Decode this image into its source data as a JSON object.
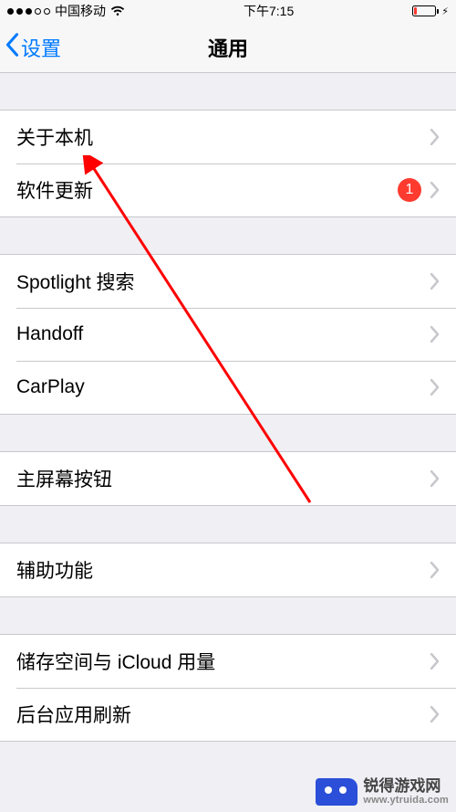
{
  "status": {
    "carrier": "中国移动",
    "time": "下午7:15",
    "signal_filled": 3,
    "signal_total": 5,
    "battery_pct": 10,
    "battery_color": "#ff3b30",
    "charging": true
  },
  "nav": {
    "back_label": "设置",
    "title": "通用"
  },
  "groups": [
    {
      "cells": [
        {
          "id": "about",
          "label": "关于本机",
          "badge": null
        },
        {
          "id": "software-update",
          "label": "软件更新",
          "badge": "1"
        }
      ]
    },
    {
      "cells": [
        {
          "id": "spotlight",
          "label": "Spotlight 搜索",
          "badge": null
        },
        {
          "id": "handoff",
          "label": "Handoff",
          "badge": null
        },
        {
          "id": "carplay",
          "label": "CarPlay",
          "badge": null
        }
      ]
    },
    {
      "cells": [
        {
          "id": "home-button",
          "label": "主屏幕按钮",
          "badge": null
        }
      ]
    },
    {
      "cells": [
        {
          "id": "accessibility",
          "label": "辅助功能",
          "badge": null
        }
      ]
    },
    {
      "cells": [
        {
          "id": "storage-icloud",
          "label": "储存空间与 iCloud 用量",
          "badge": null
        },
        {
          "id": "background-refresh",
          "label": "后台应用刷新",
          "badge": null
        }
      ]
    }
  ],
  "watermark": {
    "line1": "锐得游戏网",
    "line2": "www.ytruida.com"
  },
  "colors": {
    "tint": "#007aff",
    "badge": "#ff3b30",
    "separator": "#c8c7cc",
    "bg": "#efeff4"
  }
}
